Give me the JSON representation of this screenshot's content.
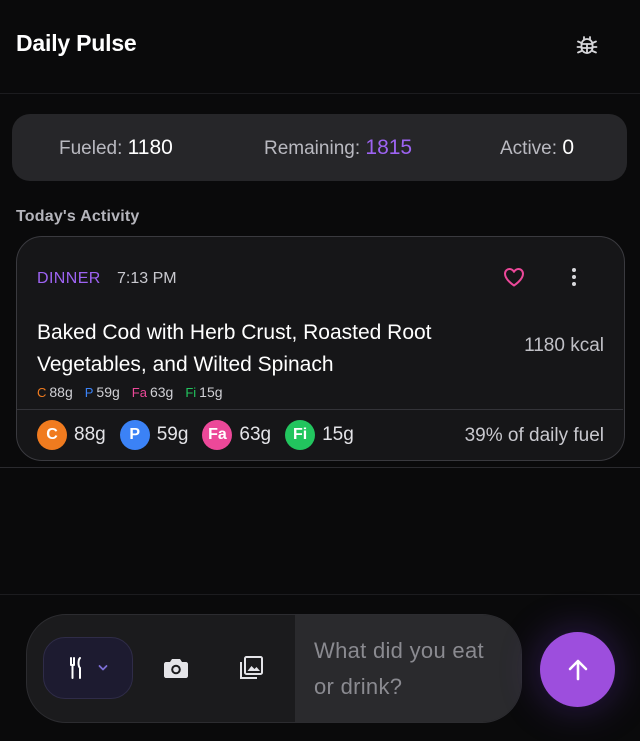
{
  "app": {
    "title": "Daily Pulse"
  },
  "icons": {
    "debug": "bug-icon",
    "favorite": "heart-icon",
    "more": "more-vertical-icon",
    "meal": "fork-knife-icon",
    "camera": "camera-icon",
    "gallery": "gallery-icon",
    "send": "arrow-up-icon"
  },
  "stats": {
    "fueled": {
      "label": "Fueled:",
      "value": "1180"
    },
    "remaining": {
      "label": "Remaining:",
      "value": "1815"
    },
    "active": {
      "label": "Active:",
      "value": "0"
    }
  },
  "activity": {
    "section_title": "Today's Activity",
    "entries": [
      {
        "meal_type": "DINNER",
        "time": "7:13 PM",
        "name": "Baked Cod with Herb Crust, Roasted Root Vegetables, and Wilted Spinach",
        "kcal": "1180 kcal",
        "mini_macros": [
          {
            "label": "C",
            "value": "88g"
          },
          {
            "label": "P",
            "value": "59g"
          },
          {
            "label": "Fa",
            "value": "63g"
          },
          {
            "label": "Fi",
            "value": "15g"
          }
        ],
        "macros": [
          {
            "badge": "C",
            "value": "88g"
          },
          {
            "badge": "P",
            "value": "59g"
          },
          {
            "badge": "Fa",
            "value": "63g"
          },
          {
            "badge": "Fi",
            "value": "15g"
          }
        ],
        "daily_fuel": "39% of daily fuel"
      }
    ]
  },
  "composer": {
    "placeholder": "What did you eat or drink?"
  },
  "colors": {
    "accent": "#9d4edd",
    "accent_text": "#9d63f2",
    "carbs": "#f07b1f",
    "protein": "#3b82f6",
    "fat": "#ec4899",
    "fiber": "#22c55e",
    "heart": "#ec4899"
  }
}
